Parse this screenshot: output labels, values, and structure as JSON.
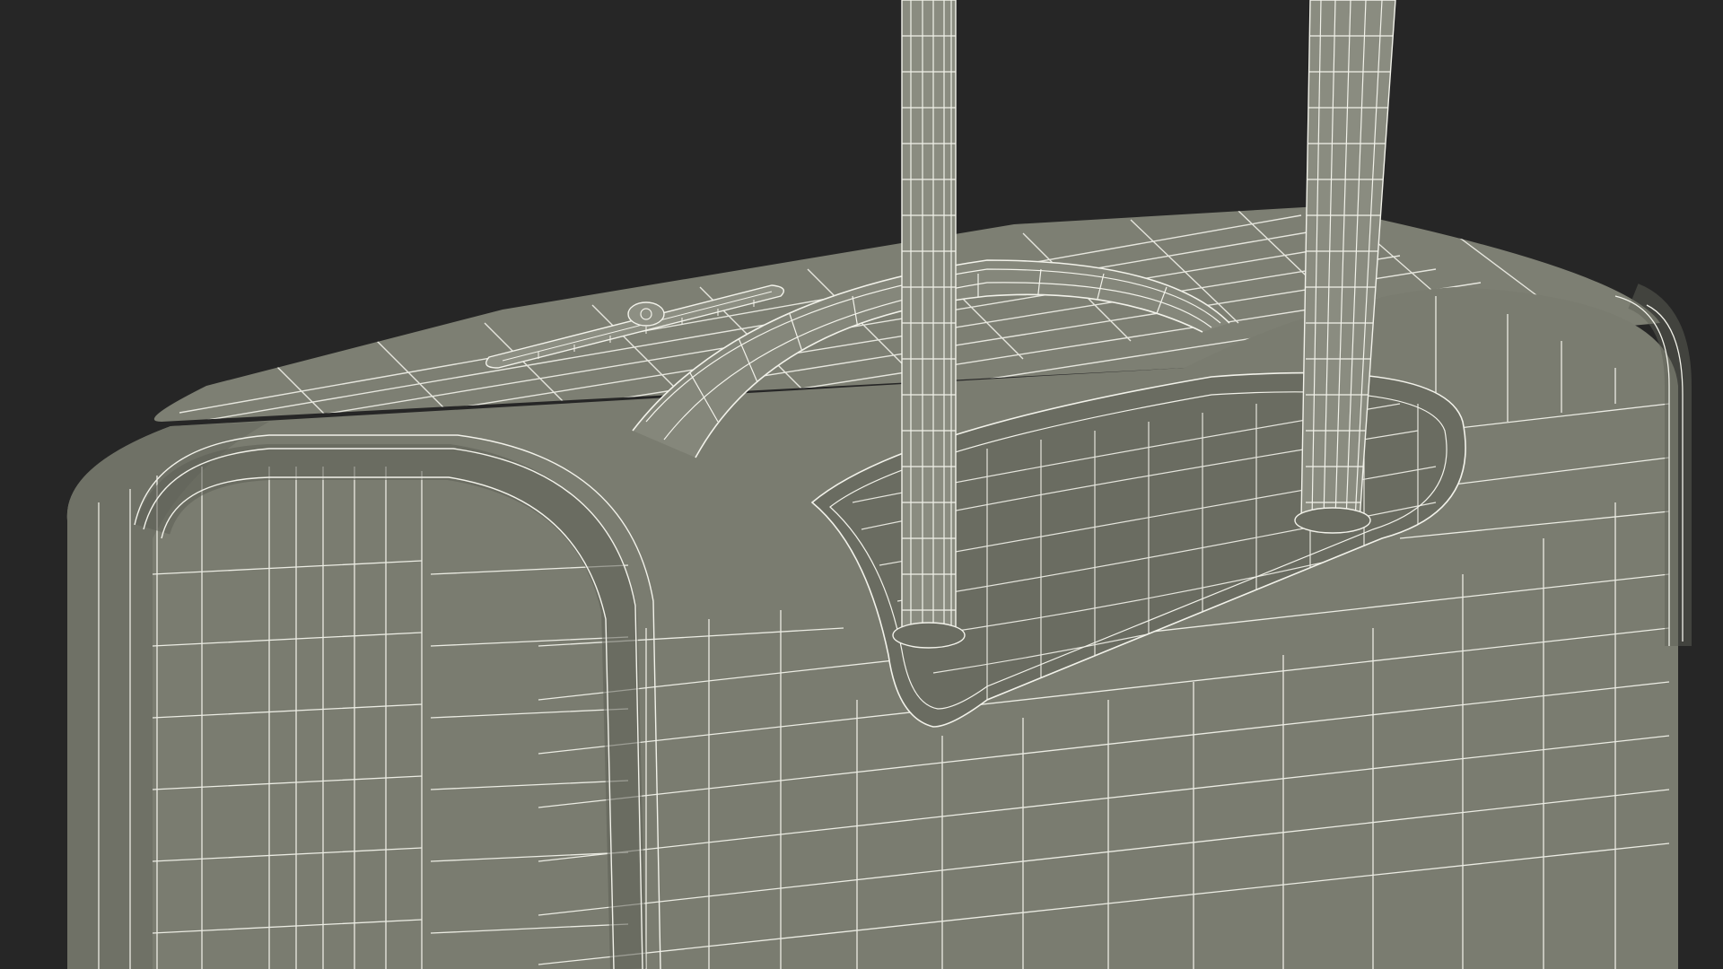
{
  "scene": {
    "subject": "suitcase-wireframe",
    "render_mode": "wireframe-on-solid",
    "colors": {
      "background": "#262626",
      "shell": "#787a6e",
      "shell_dark": "#686a5f",
      "shell_shadow": "#55574d",
      "handle_top": "#8a8c80",
      "wire": "#f2f2ea"
    },
    "parts": [
      "shell-body",
      "top-panel",
      "carry-handle",
      "telescoping-handle-left",
      "telescoping-handle-right",
      "handle-recess",
      "zipper-pull",
      "rounded-corner-edge"
    ]
  }
}
